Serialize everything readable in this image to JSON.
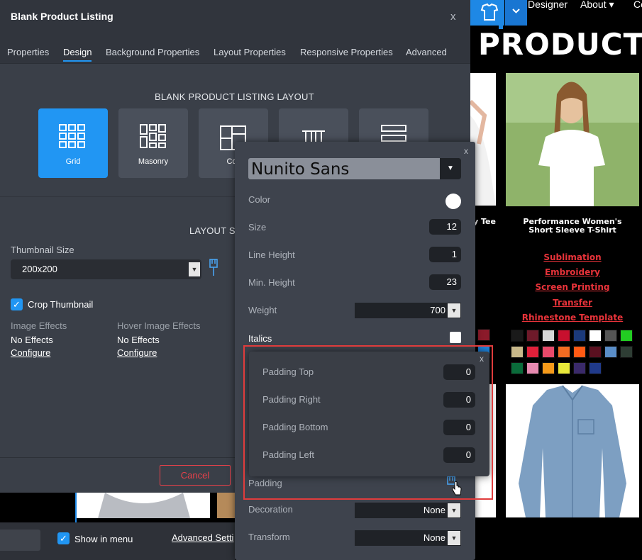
{
  "site": {
    "nav": {
      "designer": "Designer",
      "about": "About ▾",
      "cut": "Co"
    },
    "title": "PRODUCTS",
    "products": [
      {
        "name": "y Tee"
      },
      {
        "name": "Performance Women's Short Sleeve T-Shirt"
      }
    ],
    "services": [
      "Sublimation",
      "Embroidery",
      "Screen Printing",
      "Transfer",
      "Rhinestone Template"
    ],
    "swatch_colors": [
      [
        "#1a1a1a",
        "#6e1a2a",
        "#d7d7d7",
        "#c8102e",
        "#1b3a7a",
        "#ffffff",
        "#555555",
        "#22cc22"
      ],
      [
        "#c8b88a",
        "#e0203a",
        "#e84a6a",
        "#f26c22",
        "#ff5a14",
        "#5a1020",
        "#5a8ec8",
        "#2e3d34"
      ],
      [
        "#0a6b3a",
        "#e68ab0",
        "#f59a1a",
        "#e8e83a",
        "#3a2a6a",
        "#203a8a"
      ]
    ]
  },
  "dialog": {
    "title": "Blank Product Listing",
    "close": "x",
    "tabs": [
      "Properties",
      "Design",
      "Background Properties",
      "Layout Properties",
      "Responsive Properties",
      "Advanced"
    ],
    "active_tab": "Design",
    "layout_heading": "BLANK PRODUCT LISTING LAYOUT",
    "layouts": [
      "Grid",
      "Masonry",
      "Coll"
    ],
    "layout_settings_heading": "LAYOUT S",
    "thumbnail_size_label": "Thumbnail Size",
    "thumbnail_size_value": "200x200",
    "crop_thumbnail_label": "Crop Thumbnail",
    "image_effects_label": "Image Effects",
    "image_effects_value": "No Effects",
    "image_effects_link": "Configure",
    "hover_effects_label": "Hover Image Effects",
    "hover_effects_value": "No Effects",
    "hover_effects_link": "Configure",
    "cancel_label": "Cancel",
    "side_close": "x"
  },
  "bottombar": {
    "show_in_menu": "Show in menu",
    "advanced_settings": "Advanced Setti"
  },
  "typography": {
    "close": "x",
    "font": "Nunito Sans",
    "color_label": "Color",
    "size_label": "Size",
    "size_value": "12",
    "line_height_label": "Line Height",
    "line_height_value": "1",
    "min_height_label": "Min. Height",
    "min_height_value": "23",
    "weight_label": "Weight",
    "weight_value": "700",
    "italics_label": "Italics",
    "padding_label": "Padding",
    "decoration_label": "Decoration",
    "decoration_value": "None",
    "transform_label": "Transform",
    "transform_value": "None"
  },
  "padding": {
    "close": "x",
    "top_label": "Padding Top",
    "top_value": "0",
    "right_label": "Padding Right",
    "right_value": "0",
    "bottom_label": "Padding Bottom",
    "bottom_value": "0",
    "left_label": "Padding Left",
    "left_value": "0"
  },
  "colors": {
    "accent": "#2196f3",
    "highlight": "#e03c3c",
    "link_red": "#e8333a"
  }
}
